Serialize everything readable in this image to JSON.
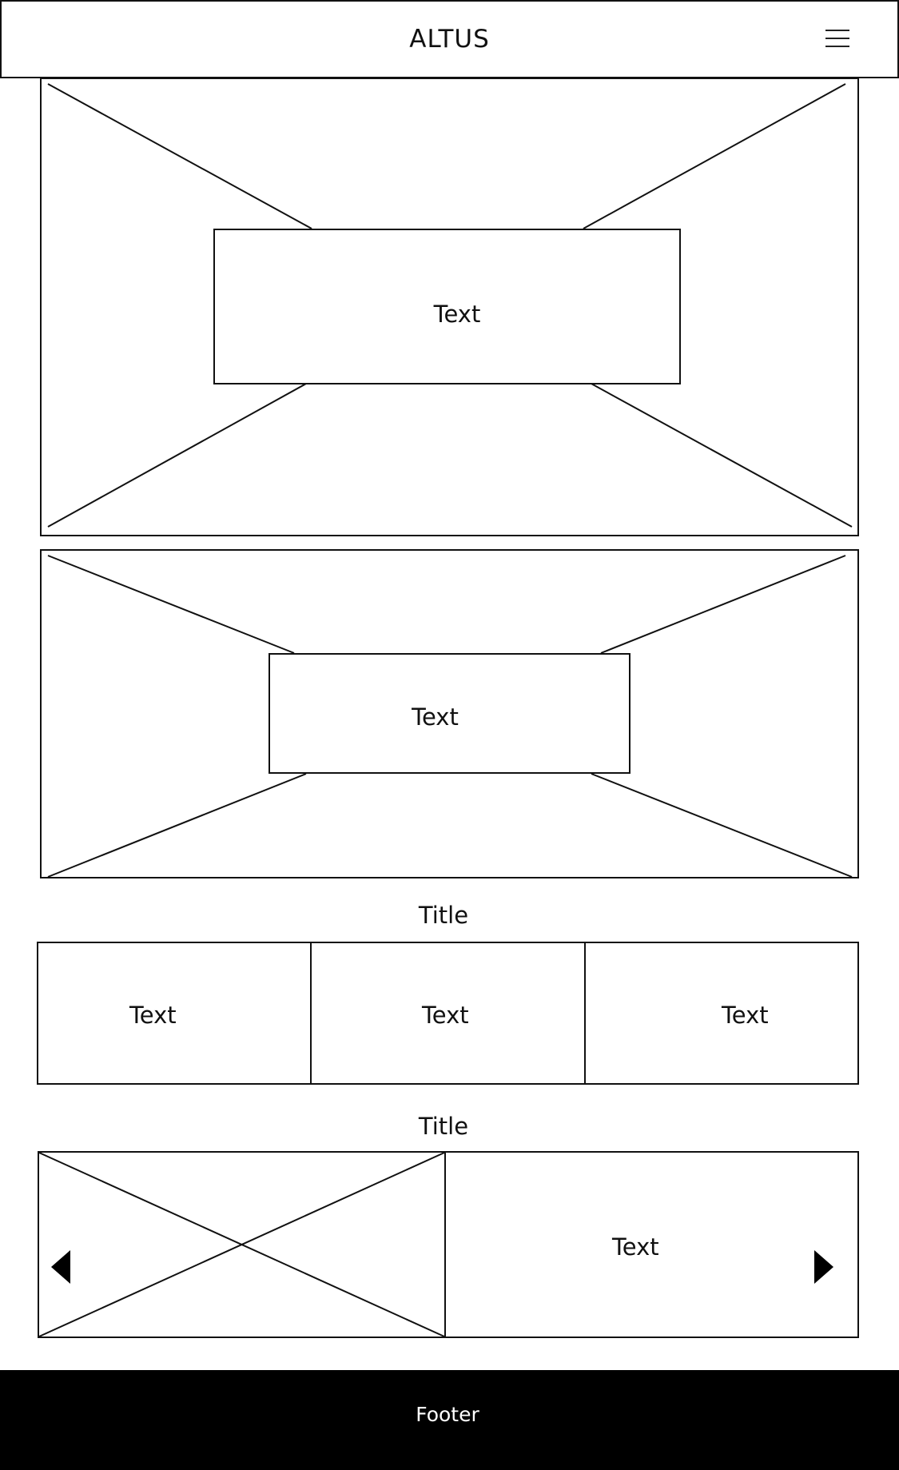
{
  "header": {
    "brand": "ALTUS",
    "menu_icon": "hamburger-menu-icon"
  },
  "hero_1": {
    "text": "Text",
    "placeholder_icon": "image-placeholder-icon"
  },
  "hero_2": {
    "text": "Text",
    "placeholder_icon": "image-placeholder-icon"
  },
  "section_1": {
    "title": "Title",
    "cards": [
      {
        "text": "Text"
      },
      {
        "text": "Text"
      },
      {
        "text": "Text"
      }
    ]
  },
  "section_2": {
    "title": "Title",
    "carousel": {
      "text": "Text",
      "image_icon": "image-placeholder-icon",
      "prev_icon": "arrow-left-icon",
      "next_icon": "arrow-right-icon"
    }
  },
  "footer": {
    "text": "Footer"
  },
  "colors": {
    "stroke": "#111111",
    "background": "#ffffff",
    "footer_background": "#000000",
    "footer_text": "#ffffff"
  }
}
